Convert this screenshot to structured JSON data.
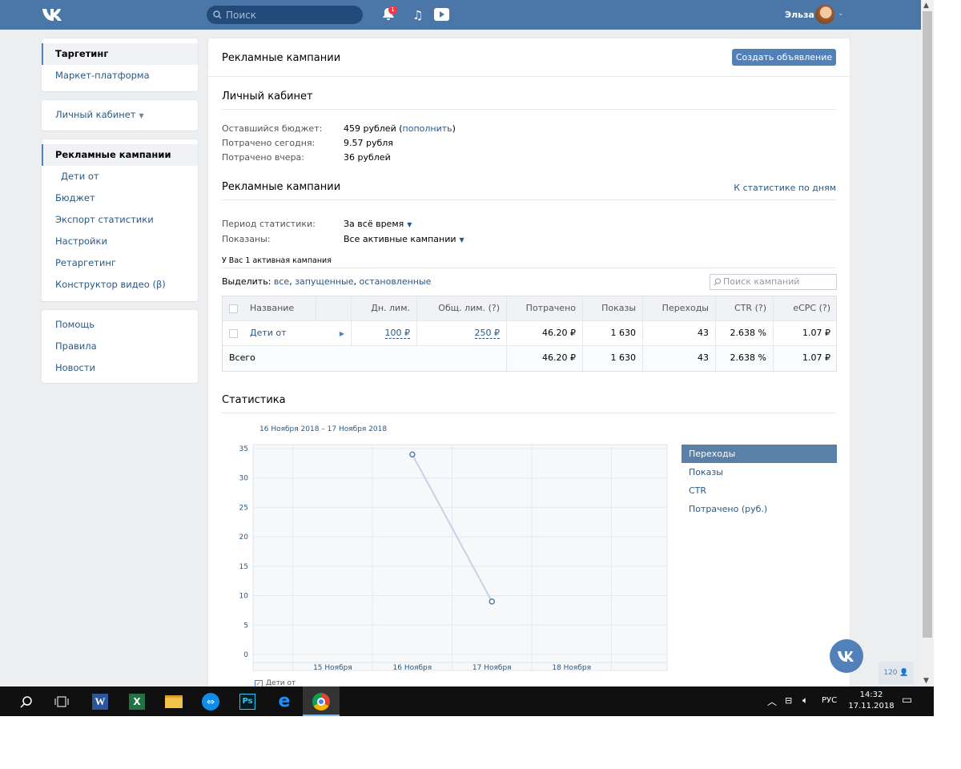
{
  "header": {
    "search_placeholder": "Поиск",
    "notification_count": "1",
    "user_name": "Эльза"
  },
  "left_menu": {
    "box1": [
      "Таргетинг",
      "Маркет-платформа"
    ],
    "box2": "Личный кабинет",
    "box3": [
      "Рекламные кампании",
      "Дети от",
      "Бюджет",
      "Экспорт статистики",
      "Настройки",
      "Ретаргетинг",
      "Конструктор видео (β)"
    ],
    "box4": [
      "Помощь",
      "Правила",
      "Новости"
    ]
  },
  "main": {
    "title": "Рекламные кампании",
    "create_button": "Создать объявление",
    "cabinet": {
      "title": "Личный кабинет",
      "rows": [
        {
          "label": "Оставшийся бюджет:",
          "value": "459 рублей",
          "link": "пополнить"
        },
        {
          "label": "Потрачено сегодня:",
          "value": "9.57 рубля"
        },
        {
          "label": "Потрачено вчера:",
          "value": "36 рублей"
        }
      ]
    },
    "campaigns": {
      "title": "Рекламные кампании",
      "stats_link": "К статистике по дням",
      "period_label": "Период статистики:",
      "period_value": "За всё время",
      "shown_label": "Показаны:",
      "shown_value": "Все активные кампании",
      "active_count": "У Вас 1 активная кампания",
      "select_label": "Выделить:",
      "select_links": [
        "все",
        "запущенные",
        "остановленные"
      ],
      "search_placeholder": "Поиск кампаний",
      "columns": [
        "Название",
        "Дн. лим.",
        "Общ. лим. (?)",
        "Потрачено",
        "Показы",
        "Переходы",
        "CTR (?)",
        "eCPC (?)"
      ],
      "rows": [
        {
          "name": "Дети от",
          "day_limit": "100 ₽",
          "total_limit": "250 ₽",
          "spent": "46.20 ₽",
          "views": "1 630",
          "clicks": "43",
          "ctr": "2.638 %",
          "ecpc": "1.07 ₽"
        }
      ],
      "total": {
        "name": "Всего",
        "spent": "46.20 ₽",
        "views": "1 630",
        "clicks": "43",
        "ctr": "2.638 %",
        "ecpc": "1.07 ₽"
      }
    },
    "stats": {
      "title": "Статистика",
      "date_range": "16 Ноября 2018 – 17 Ноября 2018",
      "legend": [
        "Переходы",
        "Показы",
        "CTR",
        "Потрачено (руб.)"
      ],
      "selected_legend": "Переходы",
      "series_checkbox": "Дети от"
    }
  },
  "chart_data": {
    "type": "line",
    "x_ticks": [
      "15 Ноября",
      "16 Ноября",
      "17 Ноября",
      "18 Ноября"
    ],
    "y_ticks": [
      "0",
      "5",
      "10",
      "15",
      "20",
      "25",
      "30",
      "35"
    ],
    "ylim": [
      0,
      35
    ],
    "series": [
      {
        "name": "Дети от",
        "points": [
          {
            "x": "16 Ноября",
            "y": 34
          },
          {
            "x": "17 Ноября",
            "y": 9
          }
        ]
      }
    ],
    "grid": true
  },
  "float": {
    "online_count": "120"
  },
  "taskbar": {
    "lang": "РУС",
    "time": "14:32",
    "date": "17.11.2018"
  }
}
